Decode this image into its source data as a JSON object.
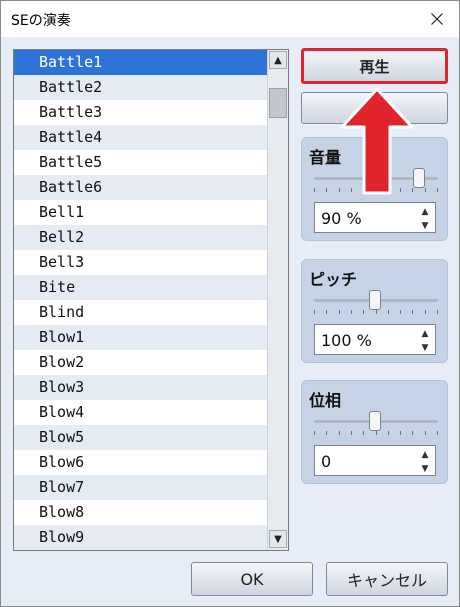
{
  "window": {
    "title": "SEの演奏"
  },
  "list": {
    "items": [
      "Battle1",
      "Battle2",
      "Battle3",
      "Battle4",
      "Battle5",
      "Battle6",
      "Bell1",
      "Bell2",
      "Bell3",
      "Bite",
      "Blind",
      "Blow1",
      "Blow2",
      "Blow3",
      "Blow4",
      "Blow5",
      "Blow6",
      "Blow7",
      "Blow8",
      "Blow9"
    ],
    "selected_index": 0
  },
  "buttons": {
    "play": "再生",
    "stop": "",
    "ok": "OK",
    "cancel": "キャンセル"
  },
  "volume": {
    "label": "音量",
    "value": "90 %",
    "level_percent": 90
  },
  "pitch": {
    "label": "ピッチ",
    "value": "100 %",
    "level_percent": 100
  },
  "phase": {
    "label": "位相",
    "value": "0",
    "level": 0
  },
  "colors": {
    "highlight": "#e1232b",
    "selection": "#2d73d8"
  },
  "annotation": {
    "icon": "up-arrow-icon"
  }
}
